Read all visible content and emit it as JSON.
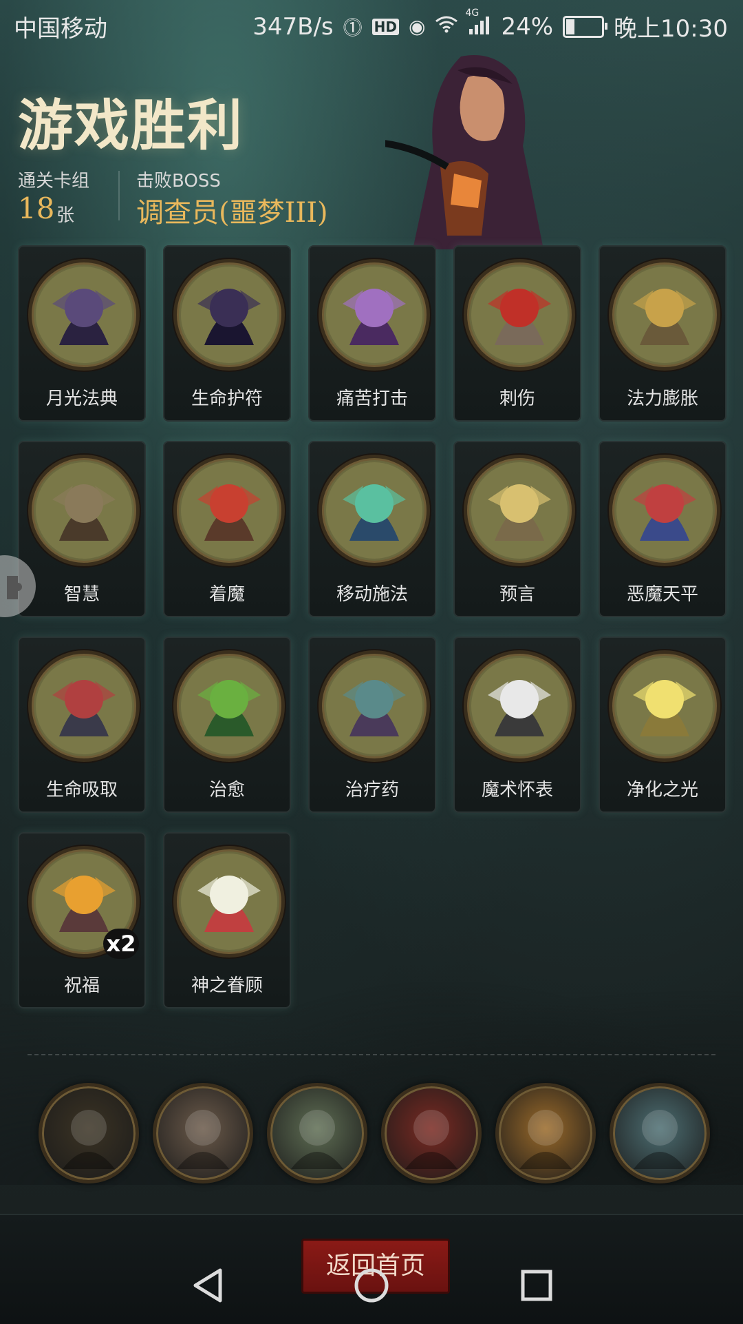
{
  "status_bar": {
    "carrier": "中国移动",
    "speed": "347B/s",
    "hd": "HD",
    "network": "4G",
    "battery": "24%",
    "battery_level": 0.24,
    "time": "晚上10:30"
  },
  "header": {
    "title": "游戏胜利",
    "deck_label": "通关卡组",
    "deck_count": "18",
    "deck_unit": "张",
    "boss_label": "击败BOSS",
    "boss_name": "调查员(噩梦III)"
  },
  "cards": [
    {
      "name": "月光法典",
      "icon": "moonlight-tome-icon"
    },
    {
      "name": "生命护符",
      "icon": "life-amulet-icon"
    },
    {
      "name": "痛苦打击",
      "icon": "pain-strike-icon"
    },
    {
      "name": "刺伤",
      "icon": "stab-icon"
    },
    {
      "name": "法力膨胀",
      "icon": "mana-surge-icon"
    },
    {
      "name": "智慧",
      "icon": "wisdom-icon"
    },
    {
      "name": "着魔",
      "icon": "possessed-icon"
    },
    {
      "name": "移动施法",
      "icon": "mobile-cast-icon"
    },
    {
      "name": "预言",
      "icon": "prophecy-icon"
    },
    {
      "name": "恶魔天平",
      "icon": "demon-scale-icon"
    },
    {
      "name": "生命吸取",
      "icon": "life-drain-icon"
    },
    {
      "name": "治愈",
      "icon": "heal-icon"
    },
    {
      "name": "治疗药",
      "icon": "healing-potion-icon"
    },
    {
      "name": "魔术怀表",
      "icon": "magic-pocket-watch-icon"
    },
    {
      "name": "净化之光",
      "icon": "purifying-light-icon"
    },
    {
      "name": "祝福",
      "icon": "blessing-icon",
      "count": "x2"
    },
    {
      "name": "神之眷顾",
      "icon": "divine-favor-icon"
    }
  ],
  "relics": [
    {
      "icon": "shadow-flame-relic-icon",
      "color": "#3b3324"
    },
    {
      "icon": "bleeding-hand-relic-icon",
      "color": "#6b5a4a"
    },
    {
      "icon": "flower-maiden-relic-icon",
      "color": "#5f6e54"
    },
    {
      "icon": "skull-hourglass-relic-icon",
      "color": "#7a2a22"
    },
    {
      "icon": "red-demon-relic-icon",
      "color": "#9a6a2a"
    },
    {
      "icon": "card-hand-relic-icon",
      "color": "#4d6e72"
    }
  ],
  "footer": {
    "home_label": "返回首页"
  },
  "colors": {
    "title": "#f2e7c8",
    "accent_gold": "#e9b85c",
    "button_red": "#8a1a16"
  }
}
